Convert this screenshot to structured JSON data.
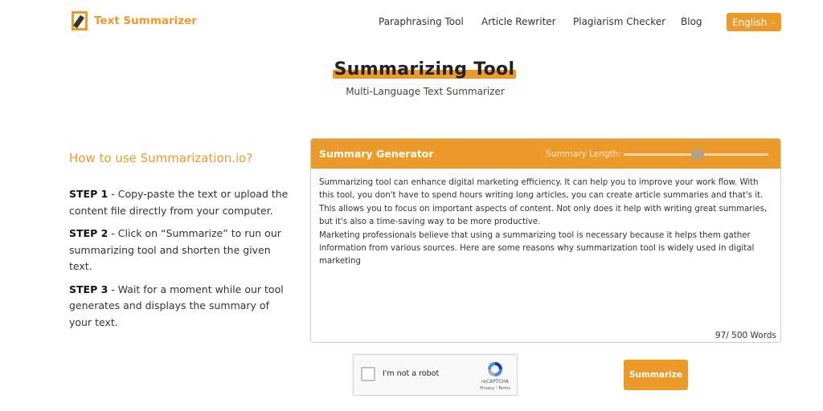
{
  "header": {
    "logo_text": "Text Summarizer",
    "nav": [
      "Paraphrasing Tool",
      "Article Rewriter",
      "Plagiarism Checker",
      "Blog"
    ],
    "language": "English"
  },
  "hero": {
    "title": "Summarizing Tool",
    "subtitle": "Multi-Language Text Summarizer"
  },
  "howto": {
    "heading": "How to use Summarization.io?",
    "steps": [
      {
        "label": "STEP 1",
        "text": " - Copy-paste the text or upload the content file directly from your computer."
      },
      {
        "label": "STEP 2",
        "text": " - Click on “Summarize” to run our summarizing tool and shorten the given text."
      },
      {
        "label": "STEP 3",
        "text": " - Wait for a moment while our tool generates and displays the summary of your text."
      }
    ]
  },
  "generator": {
    "title": "Summary Generator",
    "length_label": "Summary Length:",
    "length_value": 0.51,
    "input_text": "Summarizing tool can enhance digital marketing efficiency. It can help you to improve your work flow. With this tool, you don't have to spend hours writing long articles, you can create article summaries and that's it. This allows you to focus on important aspects of content. Not only does it help with writing great summaries, but it's also a time-saving way to be more productive.\nMarketing professionals believe that using a summarizing tool is necessary because it helps them gather information from various sources. Here are some reasons why summarization tool is widely used in digital marketing",
    "word_count": "97/ 500 Words"
  },
  "captcha": {
    "label": "I'm not a robot",
    "brand": "reCAPTCHA",
    "links": "Privacy - Terms"
  },
  "actions": {
    "summarize": "Summarize"
  },
  "colors": {
    "accent": "#ec9a2a"
  }
}
